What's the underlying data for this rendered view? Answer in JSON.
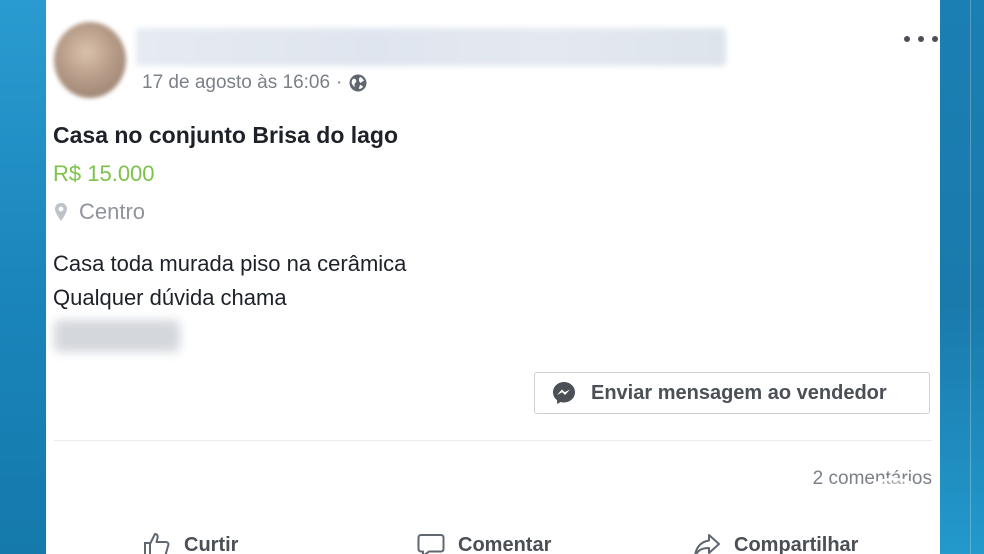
{
  "post": {
    "timestamp": "17 de agosto às 16:06",
    "separator": "·",
    "privacy_icon": "globe-icon",
    "menu_icon": "more-options-icon"
  },
  "listing": {
    "title": "Casa no conjunto Brisa do lago",
    "price": "R$ 15.000",
    "location": "Centro",
    "description_lines": [
      "Casa toda murada piso na cerâmica",
      "Qualquer dúvida chama"
    ]
  },
  "message_button": {
    "label": "Enviar mensagem ao vendedor",
    "icon": "messenger-icon"
  },
  "engagement": {
    "comments": "2 comentários"
  },
  "actions": {
    "like": "Curtir",
    "comment": "Comentar",
    "share": "Compartilhar"
  },
  "colors": {
    "price": "#7dc24a",
    "accent_blue": "#1b86b8",
    "text": "#1d2129",
    "muted": "#7b8089"
  }
}
